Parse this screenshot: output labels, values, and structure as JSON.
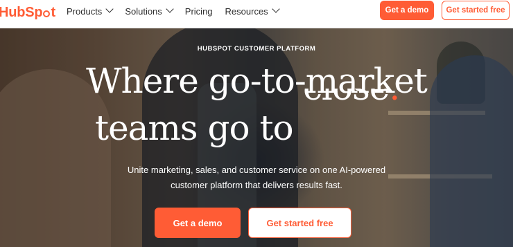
{
  "header": {
    "logo_hub": "Hub",
    "logo_spot": "Spt",
    "nav": [
      {
        "label": "Products",
        "has_dropdown": true
      },
      {
        "label": "Solutions",
        "has_dropdown": true
      },
      {
        "label": "Pricing",
        "has_dropdown": false
      },
      {
        "label": "Resources",
        "has_dropdown": true
      }
    ],
    "demo_label": "Get a demo",
    "free_label": "Get started free"
  },
  "hero": {
    "eyebrow": "HUBSPOT CUSTOMER PLATFORM",
    "line1": "Where go-to-market",
    "line2": "teams go to",
    "rotating_word": "close",
    "rotating_dot": ".",
    "subtext_line1": "Unite marketing, sales, and customer service on one AI-powered",
    "subtext_line2": "customer platform that delivers results fast.",
    "demo_label": "Get a demo",
    "free_label": "Get started free"
  },
  "colors": {
    "brand": "#ff5c35",
    "text_dark": "#2d2d2d",
    "white": "#ffffff"
  },
  "icons": [
    "chevron-down-icon",
    "hubspot-logo"
  ]
}
